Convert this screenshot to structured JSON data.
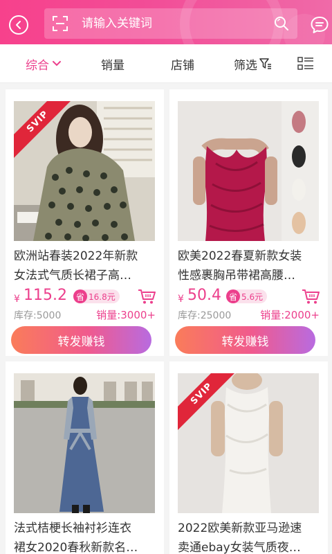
{
  "header": {
    "search_placeholder": "请输入关键词",
    "accent": "#f7418c"
  },
  "sortbar": {
    "items": [
      "综合",
      "销量",
      "店铺",
      "筛选"
    ],
    "active_index": 0
  },
  "products": [
    {
      "svip": true,
      "svip_label": "SVIP",
      "title_line1": "欧洲站春装2022年新款",
      "title_line2": "女法式气质长裙子高…",
      "currency": "¥",
      "price": "115.2",
      "save_prefix": "省",
      "save_amount": "16.8元",
      "stock": "库存:5000",
      "sales": "销量:3000+",
      "button": "转发赚钱"
    },
    {
      "svip": false,
      "title_line1": "欧美2022春夏新款女装",
      "title_line2": "性感裹胸吊带裙高腰…",
      "currency": "¥",
      "price": "50.4",
      "save_prefix": "省",
      "save_amount": "5.6元",
      "stock": "库存:25000",
      "sales": "销量:2000+",
      "button": "转发赚钱"
    },
    {
      "svip": false,
      "title_line1": "法式桔梗长袖衬衫连衣",
      "title_line2": "裙女2020春秋新款名…"
    },
    {
      "svip": true,
      "svip_label": "SVIP",
      "title_line1": "2022欧美新款亚马逊速",
      "title_line2": "卖通ebay女装气质夜…"
    }
  ]
}
